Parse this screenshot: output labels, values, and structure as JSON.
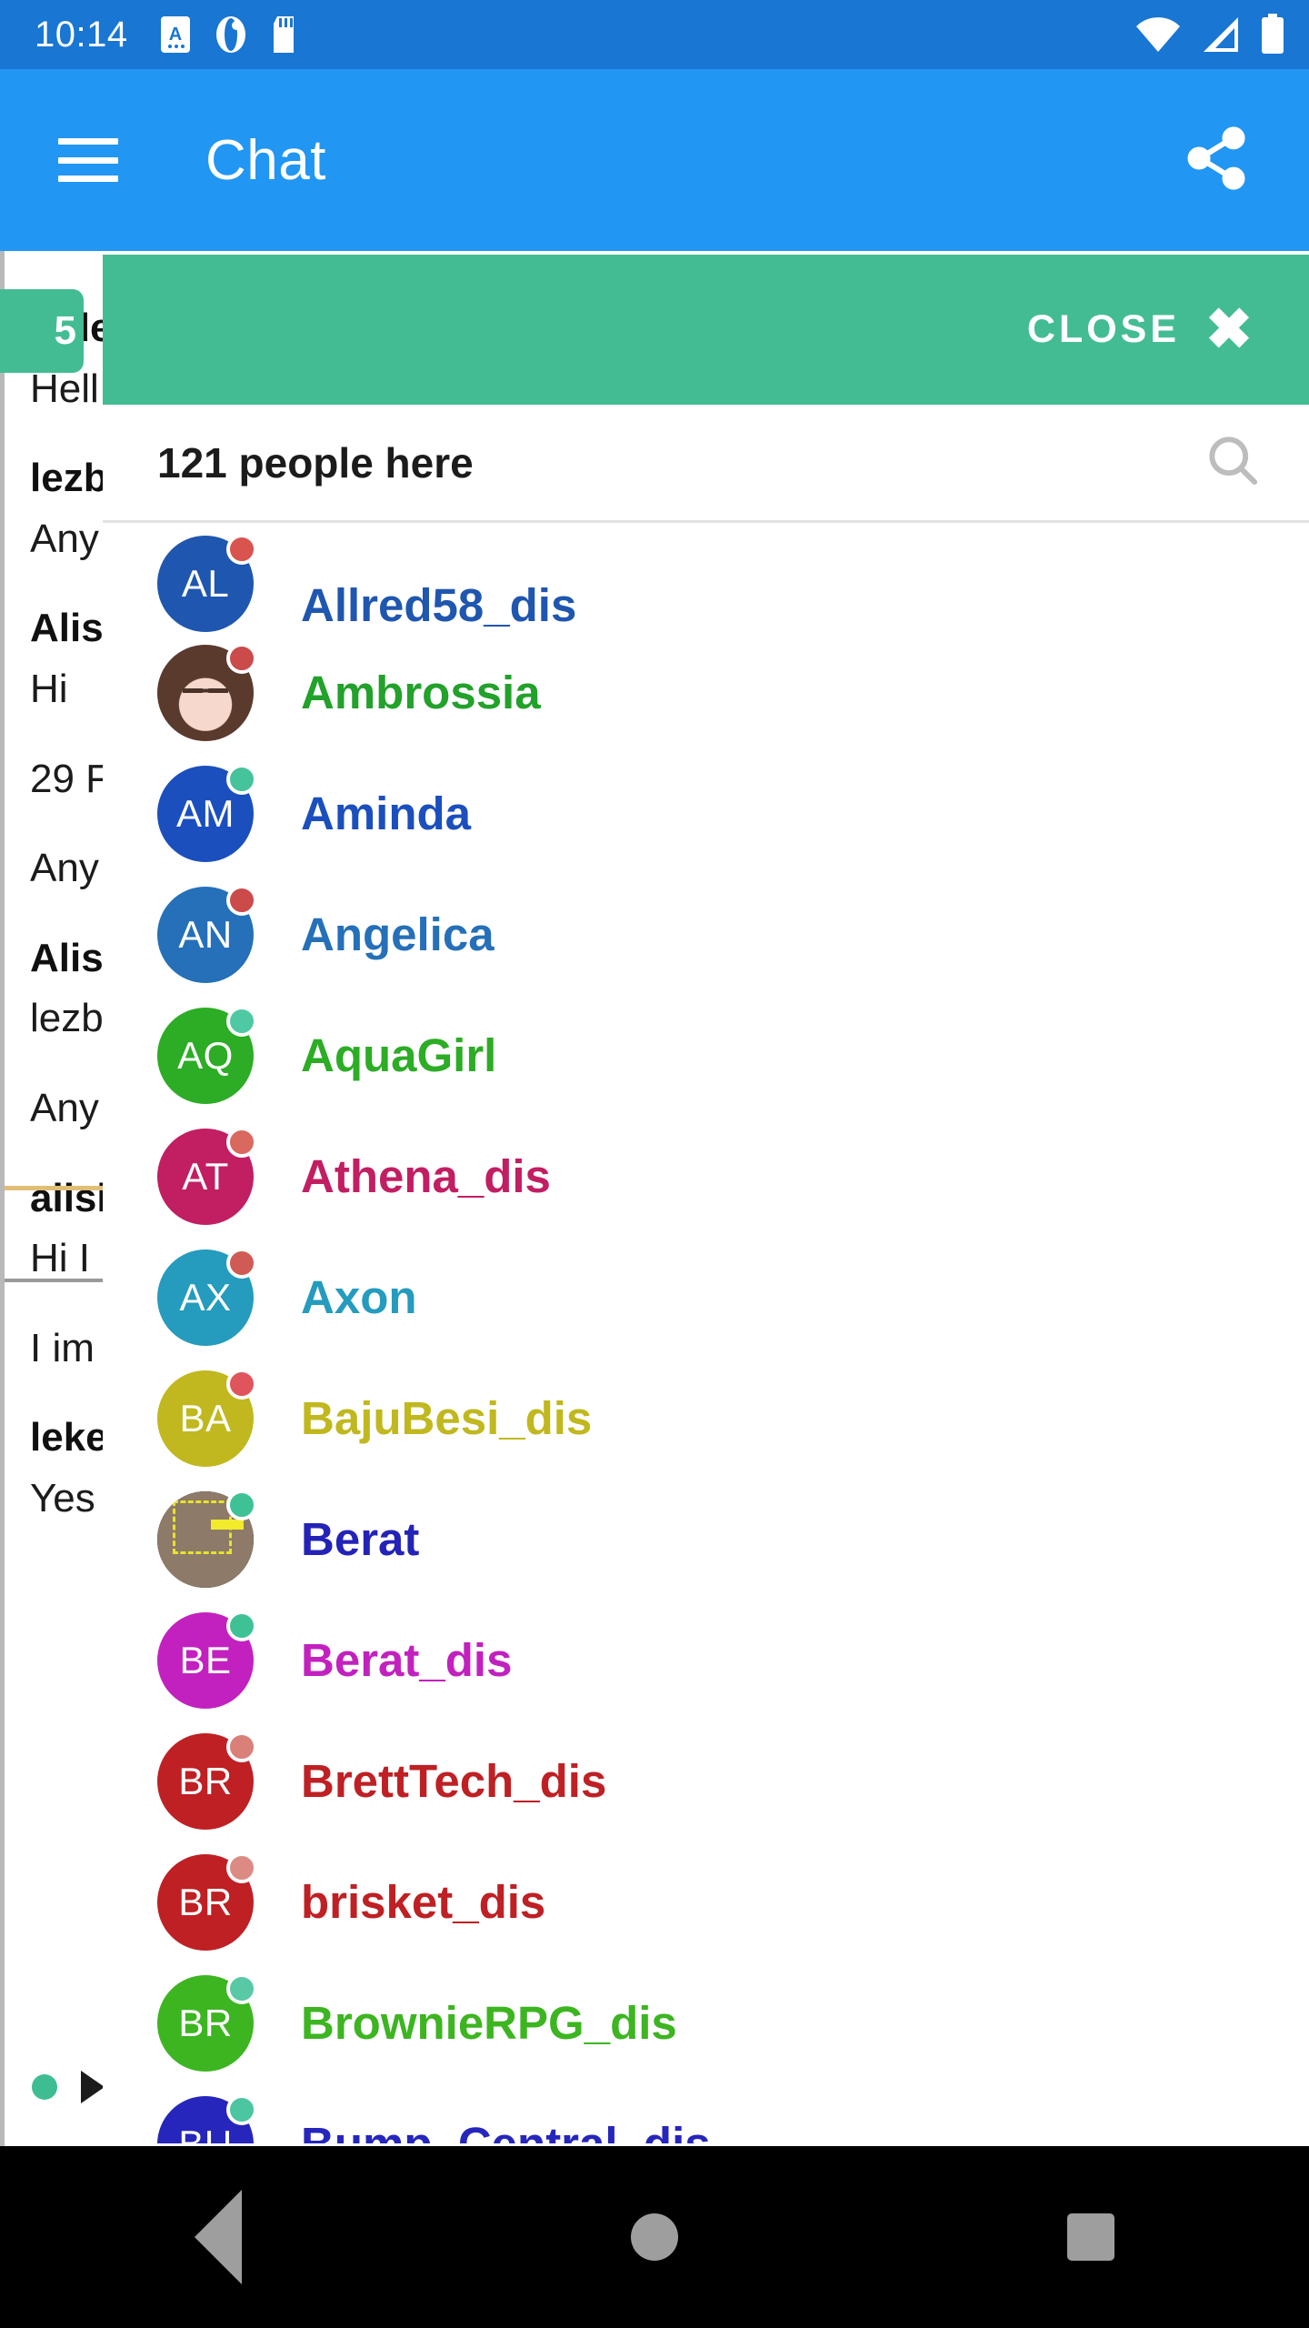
{
  "status_bar": {
    "clock": "10:14",
    "left_icons": [
      "text-input-indicator-icon",
      "do-not-disturb-icon",
      "sd-card-icon"
    ],
    "right_icons": [
      "wifi-icon",
      "cellular-signal-icon",
      "battery-icon"
    ],
    "background_color": "#1976D2"
  },
  "app_bar": {
    "menu_icon": "hamburger-menu-icon",
    "title": "Chat",
    "action_icon": "share-icon",
    "background_color": "#2196F3"
  },
  "background_chat": {
    "entries": [
      {
        "name": "fede",
        "message": "Hell"
      },
      {
        "name": "lezb",
        "message": "Any"
      },
      {
        "name": "Alis",
        "message": "Hi"
      },
      {
        "name": "29 F",
        "message": "Any"
      },
      {
        "name": "Alis",
        "message": "lezb"
      },
      {
        "name": "",
        "message": "Any"
      },
      {
        "name": "alish",
        "message": "Hi I"
      },
      {
        "name": "",
        "message": "I im"
      },
      {
        "name": "leke",
        "message": "Yes"
      }
    ],
    "divider_color": "#E0BE77"
  },
  "overlay_bar": {
    "close_label": "CLOSE",
    "close_icon": "close-x-icon",
    "back_badge_text": "5",
    "background_color": "#44BC93"
  },
  "people_panel": {
    "count_label": "121 people here",
    "search_icon": "search-icon",
    "people": [
      {
        "name": "Allred58_dis",
        "initials": "AL",
        "avatar_color": "#1F56AF",
        "name_color": "#1F56AF",
        "status": "away",
        "status_color": "#D9534F",
        "avatar_type": "initials",
        "clipped": true
      },
      {
        "name": "Ambrossia",
        "initials": "",
        "avatar_color": "#CDE4E6",
        "name_color": "#22A12B",
        "status": "away",
        "status_color": "#CB4B4B",
        "avatar_type": "photo-ambrossia"
      },
      {
        "name": "Aminda",
        "initials": "AM",
        "avatar_color": "#1B4FBE",
        "name_color": "#1B4FBE",
        "status": "online",
        "status_color": "#45C39A",
        "avatar_type": "initials"
      },
      {
        "name": "Angelica",
        "initials": "AN",
        "avatar_color": "#2570B8",
        "name_color": "#2570B8",
        "status": "away",
        "status_color": "#CB4B4B",
        "avatar_type": "initials"
      },
      {
        "name": "AquaGirl",
        "initials": "AQ",
        "avatar_color": "#2DAC25",
        "name_color": "#2DAC25",
        "status": "online",
        "status_color": "#4FC9A4",
        "avatar_type": "initials"
      },
      {
        "name": "Athena_dis",
        "initials": "AT",
        "avatar_color": "#C21E62",
        "name_color": "#C21E62",
        "status": "away",
        "status_color": "#D9685F",
        "avatar_type": "initials"
      },
      {
        "name": "Axon",
        "initials": "AX",
        "avatar_color": "#259BBE",
        "name_color": "#259BBE",
        "status": "away",
        "status_color": "#D05B55",
        "avatar_type": "initials"
      },
      {
        "name": "BajuBesi_dis",
        "initials": "BA",
        "avatar_color": "#C0B81E",
        "name_color": "#C0B81E",
        "status": "away",
        "status_color": "#E0545C",
        "avatar_type": "initials"
      },
      {
        "name": "Berat",
        "initials": "",
        "avatar_color": "#1A1A1A",
        "name_color": "#2323B8",
        "status": "online",
        "status_color": "#3FC196",
        "avatar_type": "photo-berat"
      },
      {
        "name": "Berat_dis",
        "initials": "BE",
        "avatar_color": "#C221BF",
        "name_color": "#C221BF",
        "status": "online",
        "status_color": "#3FC196",
        "avatar_type": "initials"
      },
      {
        "name": "BrettTech_dis",
        "initials": "BR",
        "avatar_color": "#BE2024",
        "name_color": "#BE2024",
        "status": "away",
        "status_color": "#D98078",
        "avatar_type": "initials"
      },
      {
        "name": "brisket_dis",
        "initials": "BR",
        "avatar_color": "#BE2024",
        "name_color": "#BE2024",
        "status": "away",
        "status_color": "#DB8B83",
        "avatar_type": "initials"
      },
      {
        "name": "BrownieRPG_dis",
        "initials": "BR",
        "avatar_color": "#3CB521",
        "name_color": "#3CB521",
        "status": "online",
        "status_color": "#59C9A5",
        "avatar_type": "initials"
      },
      {
        "name": "Bump_Central_dis",
        "initials": "BU",
        "avatar_color": "#2626BC",
        "name_color": "#2626BC",
        "status": "online",
        "status_color": "#4BC6A0",
        "avatar_type": "initials"
      }
    ]
  },
  "nav_bar": {
    "items": [
      "back-nav-icon",
      "home-nav-icon",
      "recents-nav-icon"
    ],
    "background_color": "#000000"
  }
}
